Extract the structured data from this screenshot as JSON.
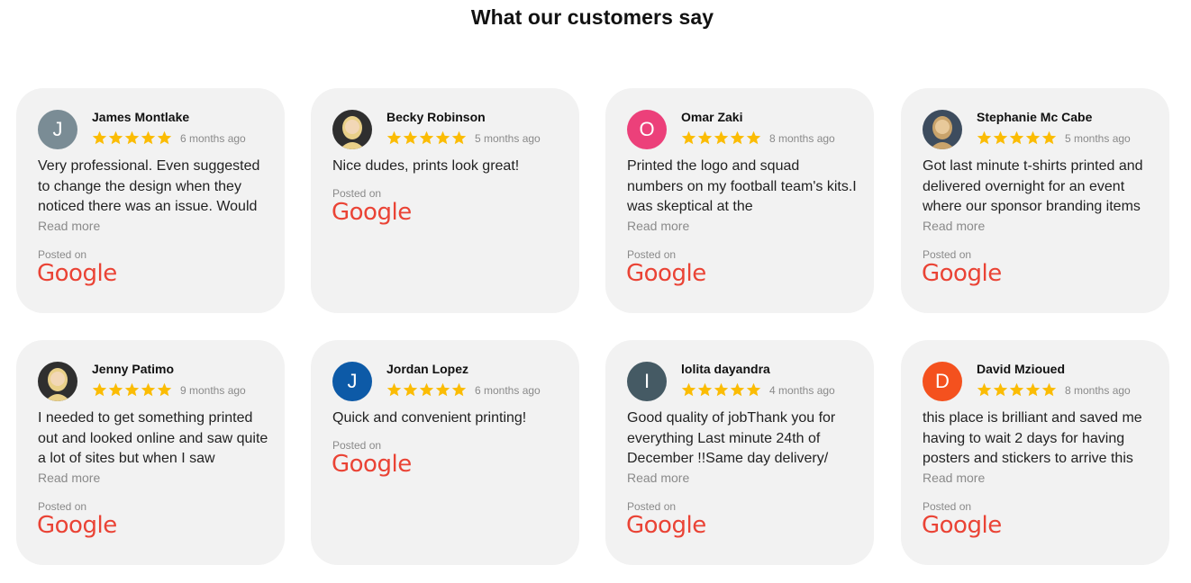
{
  "section": {
    "title": "What our customers say"
  },
  "colors": {
    "star": "#fbbc04",
    "google": "#ea4335",
    "card_bg": "#f2f2f2"
  },
  "reviews": [
    {
      "name": "James Montlake",
      "time": "6 months ago",
      "rating": 5,
      "avatar": {
        "type": "initial",
        "letter": "J",
        "color": "#7a8c95"
      },
      "text": "Very professional. Even suggested to change the design when they noticed there was an issue. Would",
      "read_more": "Read more",
      "posted_label": "Posted on",
      "platform": "Google"
    },
    {
      "name": "Becky Robinson",
      "time": "5 months ago",
      "rating": 5,
      "avatar": {
        "type": "photo",
        "icon": "user-photo-icon"
      },
      "text": "Nice dudes, prints look great!",
      "posted_label": "Posted on",
      "platform": "Google"
    },
    {
      "name": "Omar Zaki",
      "time": "8 months ago",
      "rating": 5,
      "avatar": {
        "type": "initial",
        "letter": "O",
        "color": "#ec407a"
      },
      "text": "Printed the logo and squad numbers on my football team's kits.I was skeptical at the",
      "read_more": "Read more",
      "posted_label": "Posted on",
      "platform": "Google"
    },
    {
      "name": "Stephanie Mc Cabe",
      "time": "5 months ago",
      "rating": 5,
      "avatar": {
        "type": "photo",
        "icon": "user-photo-icon"
      },
      "text": "Got last minute t-shirts printed and delivered overnight for an event where our sponsor branding items",
      "read_more": "Read more",
      "posted_label": "Posted on",
      "platform": "Google"
    },
    {
      "name": "Jenny Patimo",
      "time": "9 months ago",
      "rating": 5,
      "avatar": {
        "type": "photo",
        "icon": "user-photo-icon"
      },
      "text": "I needed to get something printed out and looked online and saw quite a lot of sites but when I saw",
      "read_more": "Read more",
      "posted_label": "Posted on",
      "platform": "Google"
    },
    {
      "name": "Jordan Lopez",
      "time": "6 months ago",
      "rating": 5,
      "avatar": {
        "type": "initial",
        "letter": "J",
        "color": "#0d5aa7"
      },
      "text": "Quick and convenient printing!",
      "posted_label": "Posted on",
      "platform": "Google"
    },
    {
      "name": "lolita dayandra",
      "time": "4 months ago",
      "rating": 5,
      "avatar": {
        "type": "initial",
        "letter": "I",
        "color": "#455a64"
      },
      "text": "Good quality of jobThank you for everything Last minute 24th of December !!Same day delivery/",
      "read_more": "Read more",
      "posted_label": "Posted on",
      "platform": "Google"
    },
    {
      "name": "David Mzioued",
      "time": "8 months ago",
      "rating": 5,
      "avatar": {
        "type": "initial",
        "letter": "D",
        "color": "#f4511e"
      },
      "text": "this place is brilliant and saved me having to wait 2 days for having posters and stickers to arrive this",
      "read_more": "Read more",
      "posted_label": "Posted on",
      "platform": "Google"
    }
  ]
}
